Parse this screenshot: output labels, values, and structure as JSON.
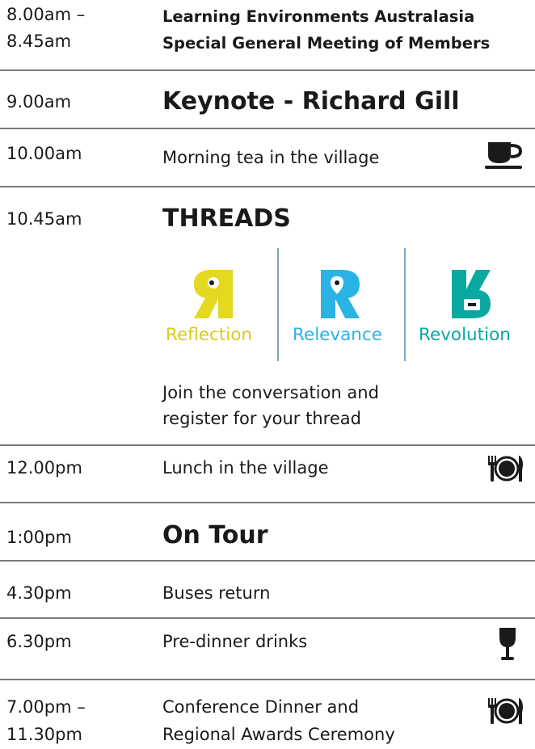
{
  "agenda": [
    {
      "time": "8.00am –",
      "time2": "8.45am",
      "line1": "Learning Environments Australasia",
      "line2": "Special General Meeting of Members"
    },
    {
      "time": "9.00am",
      "title": "Keynote - Richard Gill"
    },
    {
      "time": "10.00am",
      "title": "Morning tea in the village",
      "icon": "coffee-cup-icon"
    },
    {
      "time": "10.45am",
      "title": "THREADS"
    },
    {
      "time": "12.00pm",
      "title": "Lunch in the village",
      "icon": "plate-cutlery-icon"
    },
    {
      "time": "1:00pm",
      "title": "On Tour"
    },
    {
      "time": "4.30pm",
      "title": "Buses return"
    },
    {
      "time": "6.30pm",
      "title": "Pre-dinner drinks",
      "icon": "wine-glass-icon"
    },
    {
      "time": "7.00pm –",
      "time2": "11.30pm",
      "line1": "Conference Dinner and",
      "line2": "Regional Awards Ceremony",
      "icon": "plate-cutlery-icon"
    }
  ],
  "threads": {
    "items": [
      {
        "label": "Reflection",
        "color": "#e4d820"
      },
      {
        "label": "Relevance",
        "color": "#2bb3e6"
      },
      {
        "label": "Revolution",
        "color": "#0aa8a1"
      }
    ],
    "note_line1": "Join the conversation and",
    "note_line2": "register for your thread"
  },
  "colors": {
    "rule": "#7a7a7a",
    "text": "#1a1a1a",
    "divider": "#7fa6c4"
  }
}
